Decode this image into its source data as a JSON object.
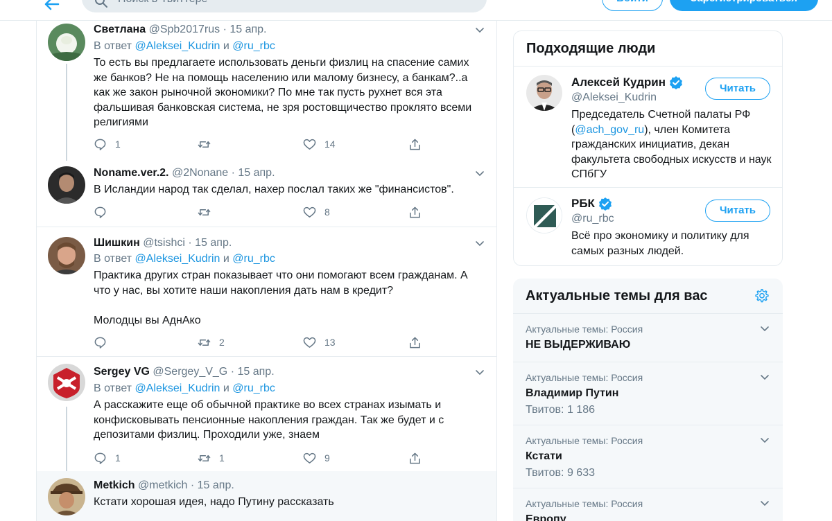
{
  "topbar": {
    "search_placeholder": "Поиск в Твиттере",
    "login_label": "Войти",
    "signup_label": "Зарегистрироваться"
  },
  "tweets": [
    {
      "name": "Светлана",
      "handle": "@Spb2017rus",
      "dot": "·",
      "time": "15 апр.",
      "reply_prefix": "В ответ",
      "reply_m1": "@Aleksei_Kudrin",
      "reply_and": "и",
      "reply_m2": "@ru_rbc",
      "text": "То есть вы предлагаете использовать деньги физлиц на спасение самих же банков? Не на помощь населению или малому бизнесу, а банкам?..а как же закон рыночной экономики? По мне так пусть рухнет вся эта фальшивая банковская система, не зря ростовщичество проклято всеми религиями",
      "replies": "1",
      "retweets": "",
      "likes": "14"
    },
    {
      "name": "Noname.ver.2.",
      "handle": "@2Nonane",
      "dot": "·",
      "time": "15 апр.",
      "text": "В Исландии народ так сделал, нахер послал таких же \"финансистов\".",
      "replies": "",
      "retweets": "",
      "likes": "8"
    },
    {
      "name": "Шишкин",
      "handle": "@tsishci",
      "dot": "·",
      "time": "15 апр.",
      "reply_prefix": "В ответ",
      "reply_m1": "@Aleksei_Kudrin",
      "reply_and": "и",
      "reply_m2": "@ru_rbc",
      "text": "Практика других стран показывает что они помогают всем гражданам. А что у нас, вы хотите наши накопления дать нам в кредит?",
      "text2": "Молодцы вы АднАко",
      "replies": "",
      "retweets": "2",
      "likes": "13"
    },
    {
      "name": "Sergey VG",
      "handle": "@Sergey_V_G",
      "dot": "·",
      "time": "15 апр.",
      "reply_prefix": "В ответ",
      "reply_m1": "@Aleksei_Kudrin",
      "reply_and": "и",
      "reply_m2": "@ru_rbc",
      "text": "А расскажите еще об обычной практике во всех странах изымать и конфисковывать пенсионные накопления граждан. Так же будет и с депозитами физлиц. Проходили уже, знаем",
      "replies": "1",
      "retweets": "1",
      "likes": "9"
    },
    {
      "name": "Metkich",
      "handle": "@metkich",
      "dot": "·",
      "time": "15 апр.",
      "text": "Кстати хорошая идея, надо Путину рассказать"
    }
  ],
  "who_to_follow": {
    "title": "Подходящие люди",
    "people": [
      {
        "name": "Алексей Кудрин",
        "handle": "@Aleksei_Kudrin",
        "bio_before": "Председатель Счетной палаты РФ (",
        "bio_link": "@ach_gov_ru",
        "bio_after": "), член Комитета гражданских инициатив, декан факультета свободных искусств и наук СПбГУ",
        "follow_label": "Читать"
      },
      {
        "name": "РБК",
        "handle": "@ru_rbc",
        "bio": "Всё про экономику и политику для самых разных людей.",
        "follow_label": "Читать"
      }
    ]
  },
  "trends": {
    "title": "Актуальные темы для вас",
    "items": [
      {
        "context": "Актуальные темы: Россия",
        "name": "НЕ ВЫДЕРЖИВАЮ",
        "count": ""
      },
      {
        "context": "Актуальные темы: Россия",
        "name": "Владимир Путин",
        "count": "Твитов: 1 186"
      },
      {
        "context": "Актуальные темы: Россия",
        "name": "Кстати",
        "count": "Твитов: 9 633"
      },
      {
        "context": "Актуальные темы: Россия",
        "name": "Европу",
        "count": ""
      }
    ]
  },
  "colors": {
    "accent": "#1da1f2",
    "link": "#1b95e0",
    "muted": "#657786",
    "verified": "#1da1f2"
  }
}
